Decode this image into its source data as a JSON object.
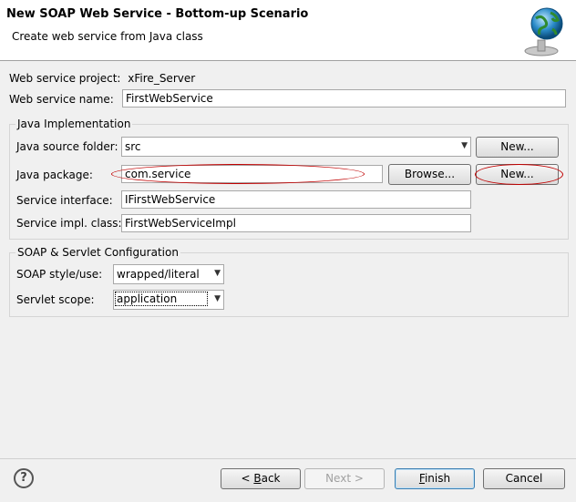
{
  "header": {
    "title": "New SOAP Web Service - Bottom-up Scenario",
    "subtitle": "Create web service from Java class",
    "icon": "globe-icon"
  },
  "form": {
    "project_label": "Web service project:",
    "project_value": "xFire_Server",
    "name_label": "Web service name:",
    "name_value": "FirstWebService"
  },
  "java_impl": {
    "group_title": "Java Implementation",
    "source_folder_label": "Java source folder:",
    "source_folder_value": "src",
    "source_new_button": "New...",
    "package_label": "Java package:",
    "package_value": "com.service",
    "browse_button": "Browse...",
    "package_new_button": "New...",
    "interface_label": "Service interface:",
    "interface_value": "IFirstWebService",
    "impl_label": "Service impl. class:",
    "impl_value": "FirstWebServiceImpl"
  },
  "soap_config": {
    "group_title": "SOAP & Servlet Configuration",
    "style_label": "SOAP style/use:",
    "style_value": "wrapped/literal",
    "scope_label": "Servlet scope:",
    "scope_value": "application"
  },
  "footer": {
    "back_button_prefix": "< ",
    "back_button_mnemonic": "B",
    "back_button_rest": "ack",
    "next_button": "Next >",
    "finish_button_mnemonic": "F",
    "finish_button_rest": "inish",
    "cancel_button": "Cancel"
  },
  "colors": {
    "annotation": "#c00000",
    "accent": "#3c7fb1"
  }
}
